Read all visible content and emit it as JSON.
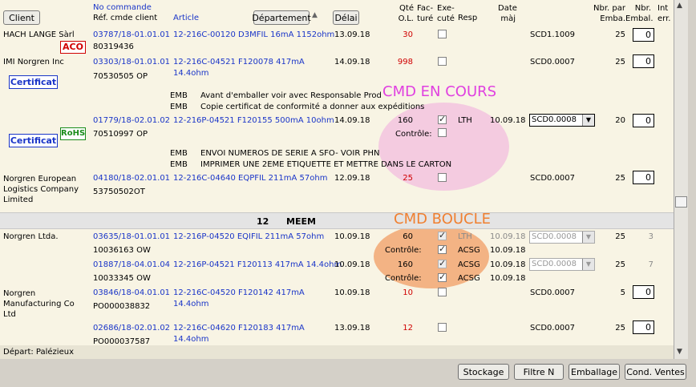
{
  "header": {
    "client_btn": "Client",
    "no_commande": "No commande",
    "ref_cmde": "Réf. cmde client",
    "article": "Article",
    "departement_btn": "Département",
    "delai_btn": "Délai",
    "qte1": "Qté",
    "qte2": "O.L.",
    "fac1": "Fac-",
    "fac2": "turé",
    "exe1": "Exe-",
    "exe2": "cuté",
    "resp": "Resp",
    "date1": "Date",
    "date2": "màj",
    "nbr_par1": "Nbr. par",
    "nbr_par2": "Emba.",
    "nbr_emb1": "Nbr.",
    "nbr_emb2": "Embal.",
    "int1": "Int",
    "int2": "err."
  },
  "rows": {
    "r1": {
      "client": "HACH LANGE Sàrl",
      "badge": "ACO",
      "order": "03787/18-01.01.01",
      "ref": "80319436",
      "article": "12-216C-00120 D3MFIL 16mA 1152ohm",
      "date": "13.09.18",
      "qty": "30",
      "scd": "SCD1.1009",
      "par": "25",
      "nbr": "0"
    },
    "r2": {
      "client": "IMI Norgren Inc",
      "badge": "Certificat",
      "order": "03303/18-01.01.01",
      "ref": "70530505 OP",
      "article1": "12-216C-04521 F120078 417mA",
      "article2": "14.4ohm",
      "date": "14.09.18",
      "qty": "998",
      "scd": "SCD0.0007",
      "par": "25",
      "nbr": "0"
    },
    "emb1": {
      "code1": "EMB",
      "text1": "Avant d'emballer voir avec Responsable Prod",
      "code2": "EMB",
      "text2": "Copie certificat de conformité a donner aux expéditions"
    },
    "r3": {
      "badge_rohs": "RoHS",
      "badge": "Certificat",
      "order": "01779/18-02.01.02",
      "ref": "70510997 OP",
      "article": "12-216P-04521 F120155 500mA 10ohm",
      "date": "14.09.18",
      "qty": "160",
      "controle": "Contrôle:",
      "resp": "LTH",
      "datemaj": "10.09.18",
      "scd": "SCD0.0008",
      "par": "20",
      "nbr": "0"
    },
    "emb2": {
      "code1": "EMB",
      "text1": "ENVOI NUMEROS DE SERIE A SFO- VOIR PHN",
      "code2": "EMB",
      "text2": "IMPRIMER UNE 2EME ETIQUETTE ET METTRE DANS LE CARTON"
    },
    "r4": {
      "client1": "Norgren European",
      "client2": "Logistics Company",
      "client3": "Limited",
      "order": "04180/18-02.01.01",
      "ref": "53750502OT",
      "article": "12-216C-04640 EQPFIL 211mA 57ohm",
      "date": "12.09.18",
      "qty": "25",
      "scd": "SCD0.0007",
      "par": "25",
      "nbr": "0"
    },
    "group": {
      "num": "12",
      "name": "MEEM"
    },
    "r5": {
      "client": "Norgren Ltda.",
      "order": "03635/18-01.01.01",
      "ref": "10036163 OW",
      "article": "12-216P-04520 EQIFIL 211mA 57ohm",
      "date": "10.09.18",
      "qty": "60",
      "controle": "Contrôle:",
      "resp1": "LTH",
      "resp2": "ACSG",
      "datemaj1": "10.09.18",
      "datemaj2": "10.09.18",
      "scd": "SCD0.0008",
      "par": "25",
      "int": "3"
    },
    "r6": {
      "order": "01887/18-04.01.04",
      "ref": "10033345 OW",
      "article": "12-216P-04521 F120113 417mA 14.4ohm",
      "date": "10.09.18",
      "qty": "160",
      "controle": "Contrôle:",
      "resp1": "ACSG",
      "resp2": "ACSG",
      "datemaj1": "10.09.18",
      "datemaj2": "10.09.18",
      "scd": "SCD0.0008",
      "par": "25",
      "int": "7"
    },
    "r7": {
      "client1": "Norgren",
      "client2": "Manufacturing Co",
      "client3": "Ltd",
      "order": "03846/18-04.01.01",
      "ref": "PO000038832",
      "article1": "12-216C-04520 F120142 417mA",
      "article2": "14.4ohm",
      "date": "10.09.18",
      "qty": "10",
      "scd": "SCD0.0007",
      "par": "5",
      "nbr": "0"
    },
    "r8": {
      "order": "02686/18-02.01.02",
      "ref": "PO000037587",
      "article1": "12-216C-04620 F120183 417mA",
      "article2": "14.4ohm",
      "date": "13.09.18",
      "qty": "12",
      "scd": "SCD0.0007",
      "par": "25",
      "nbr": "0"
    }
  },
  "footer": {
    "depart": "Départ: Palézieux"
  },
  "overlay": {
    "cmd_en_cours": "CMD EN COURS",
    "cmd_boucle": "CMD BOUCLE"
  },
  "buttons": {
    "stockage": "Stockage",
    "filtre": "Filtre N",
    "emballage": "Emballage",
    "cond_ventes": "Cond. Ventes"
  }
}
